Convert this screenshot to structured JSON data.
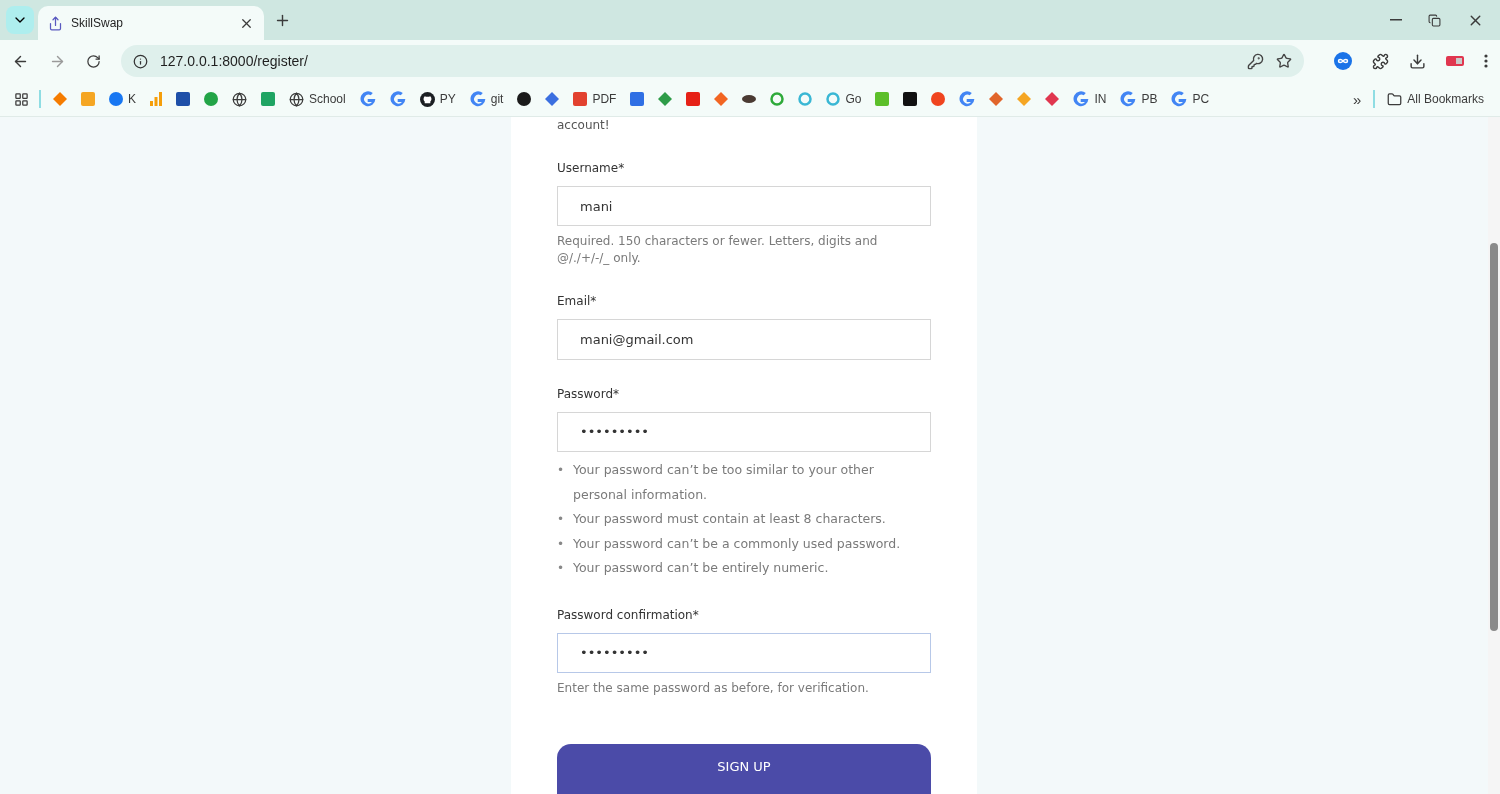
{
  "tab": {
    "title": "SkillSwap",
    "selected": true
  },
  "address": "127.0.0.1:8000/register/",
  "bookmarks": [
    {
      "kind": "diamond",
      "color": "#f57c00"
    },
    {
      "kind": "square",
      "color": "#f5a623"
    },
    {
      "kind": "circle",
      "color": "#1877f2",
      "label": "K"
    },
    {
      "kind": "bars",
      "color": "#f59e0b"
    },
    {
      "kind": "square",
      "color": "#1e4fa8"
    },
    {
      "kind": "circle",
      "color": "#22a447"
    },
    {
      "kind": "globe",
      "color": "#3c3c3c"
    },
    {
      "kind": "square",
      "color": "#1fa463"
    },
    {
      "kind": "globe",
      "color": "#3c3c3c",
      "label": "School"
    },
    {
      "kind": "google",
      "color": "#4285f4"
    },
    {
      "kind": "google",
      "color": "#4285f4"
    },
    {
      "kind": "github",
      "color": "#1b1f23",
      "label": "PY"
    },
    {
      "kind": "google",
      "color": "#4285f4",
      "label": "git"
    },
    {
      "kind": "circle",
      "color": "#1b1b1b"
    },
    {
      "kind": "diamond",
      "color": "#3b6fe0"
    },
    {
      "kind": "square",
      "color": "#e2412f",
      "label": "PDF"
    },
    {
      "kind": "square",
      "color": "#2f6fe4"
    },
    {
      "kind": "diamond",
      "color": "#2e9c48"
    },
    {
      "kind": "square",
      "color": "#e62117"
    },
    {
      "kind": "diamond",
      "color": "#f26522"
    },
    {
      "kind": "oval",
      "color": "#4a3a33"
    },
    {
      "kind": "ring",
      "color": "#2eaa3a"
    },
    {
      "kind": "ring",
      "color": "#3ab7d4"
    },
    {
      "kind": "ring",
      "color": "#3ab7d4",
      "label": "Go"
    },
    {
      "kind": "square",
      "color": "#5cbf2a"
    },
    {
      "kind": "square",
      "color": "#111111"
    },
    {
      "kind": "circle",
      "color": "#f0441f"
    },
    {
      "kind": "google",
      "color": "#4285f4"
    },
    {
      "kind": "diamond",
      "color": "#e1652b"
    },
    {
      "kind": "diamond",
      "color": "#f5a623"
    },
    {
      "kind": "diamond",
      "color": "#e0364f"
    },
    {
      "kind": "google",
      "color": "#4285f4",
      "label": "IN"
    },
    {
      "kind": "google",
      "color": "#4285f4",
      "label": "PB"
    },
    {
      "kind": "google",
      "color": "#4285f4",
      "label": "PC"
    }
  ],
  "overflow": "»",
  "all_bookmarks": "All Bookmarks",
  "form": {
    "intro": "account!",
    "fields": [
      {
        "label": "Username*",
        "value": "mani",
        "focused": false,
        "help": "Required. 150 characters or fewer. Letters, digits and @/./+/-/_ only."
      },
      {
        "label": "Email*",
        "value": "mani@gmail.com",
        "focused": false
      },
      {
        "label": "Password*",
        "value": "•••••••••",
        "focused": false,
        "rules": [
          {
            "marker": "•",
            "text": "Your password can’t be too similar to your other personal information."
          },
          {
            "marker": "•",
            "text": "Your password must contain at least 8 characters."
          },
          {
            "marker": "•",
            "text": "Your password can’t be a commonly used password."
          },
          {
            "marker": "•",
            "text": "Your password can’t be entirely numeric."
          }
        ]
      },
      {
        "label": "Password confirmation*",
        "value": "•••••••••",
        "focused": true,
        "help": "Enter the same password as before, for verification."
      }
    ],
    "submit": "SIGN UP"
  }
}
